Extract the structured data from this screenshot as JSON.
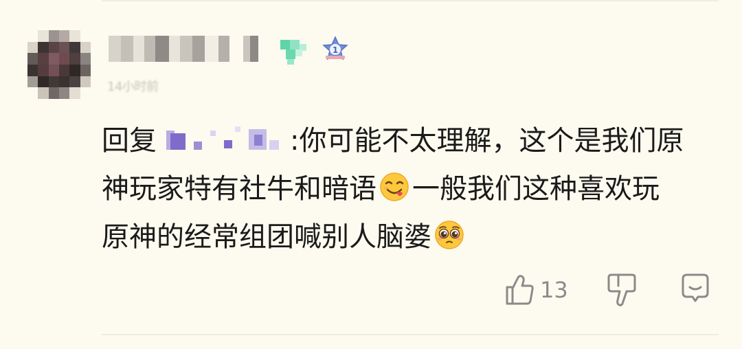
{
  "comment": {
    "timestamp": "14小时前",
    "reply_prefix": "回复",
    "reply_separator": ":",
    "line1_text": "你可能不太理解，这个是我们原",
    "line2_text_a": "神玩家特有社牛和暗语",
    "line2_text_b": "一般我们这种喜欢玩",
    "line3_text": "原神的经常组团喊别人脑婆",
    "emoji_1": "yum-face-icon",
    "emoji_2": "pleading-face-icon"
  },
  "actions": {
    "like_count": "13",
    "like_icon": "thumbs-up-icon",
    "dislike_icon": "thumbs-down-icon",
    "reply_icon": "comment-icon"
  },
  "colors": {
    "background": "#fdfaef",
    "text": "#1a1a1a",
    "muted": "#8a8a8a",
    "mention_purple": "#7d6cc9",
    "level_badge": "#5fd4a8",
    "rank_badge": "#6f8fd8"
  }
}
